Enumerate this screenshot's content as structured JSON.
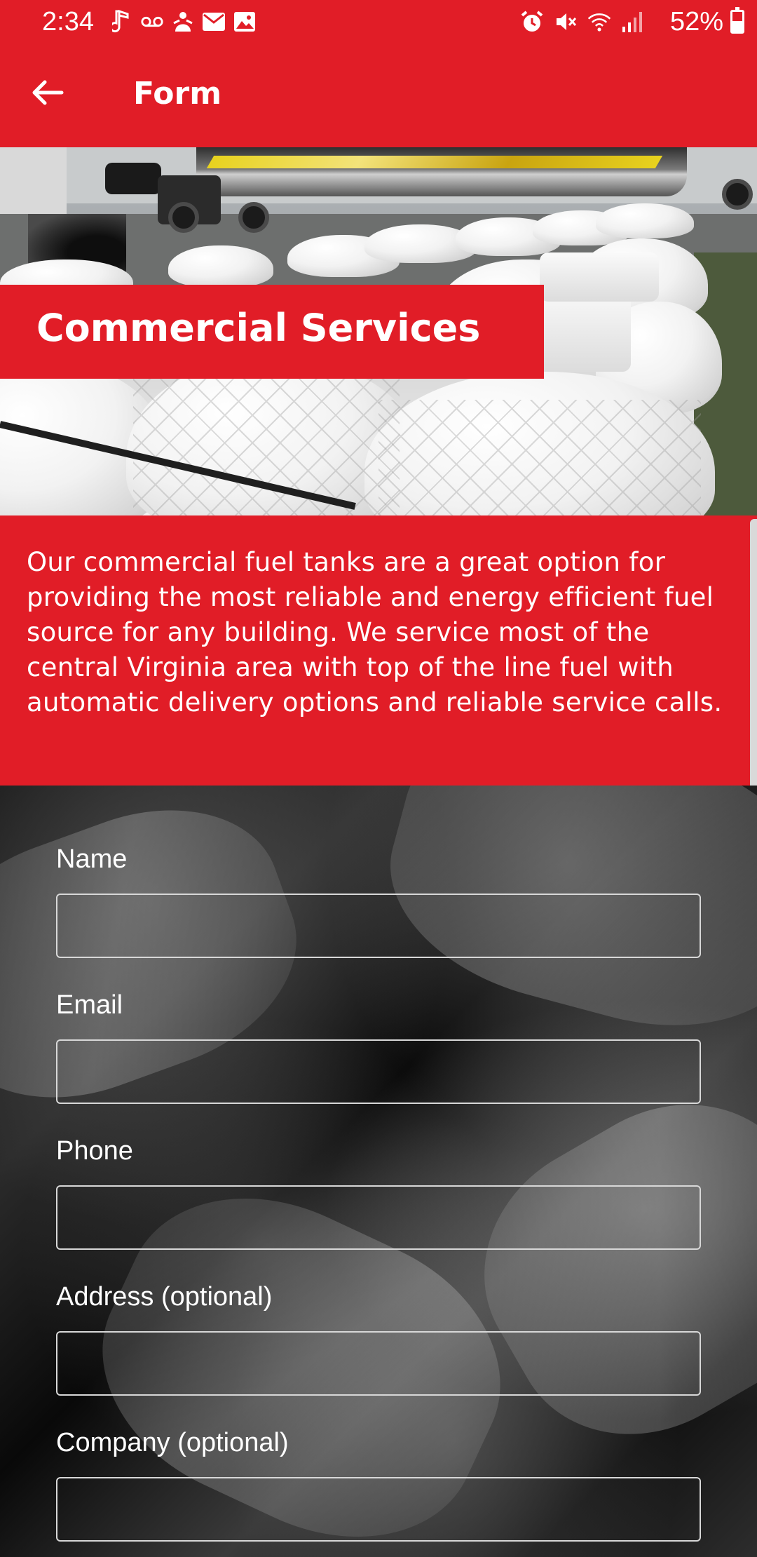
{
  "status_bar": {
    "time": "2:34",
    "battery": "52%",
    "battery_level": 0.52,
    "left_icons": [
      "music-note-icon",
      "voicemail-icon",
      "bridgefy-icon",
      "mail-icon",
      "image-icon"
    ],
    "right_icons": [
      "alarm-icon",
      "mute-icon",
      "wifi-icon",
      "signal-icon"
    ]
  },
  "app_bar": {
    "title": "Form",
    "back_icon": "arrow-left-icon"
  },
  "hero": {
    "banner_title": "Commercial Services"
  },
  "description": {
    "text": "Our commercial fuel tanks are a great option for providing the most reliable and energy efficient fuel source for any building. We service most of the central Virginia area with top of the line fuel with automatic delivery options and reliable service calls."
  },
  "form": {
    "fields": [
      {
        "label": "Name",
        "value": ""
      },
      {
        "label": "Email",
        "value": ""
      },
      {
        "label": "Phone",
        "value": ""
      },
      {
        "label": "Address (optional)",
        "value": ""
      },
      {
        "label": "Company (optional)",
        "value": ""
      }
    ]
  },
  "colors": {
    "accent_red": "#e11d27",
    "text_white": "#ffffff"
  }
}
